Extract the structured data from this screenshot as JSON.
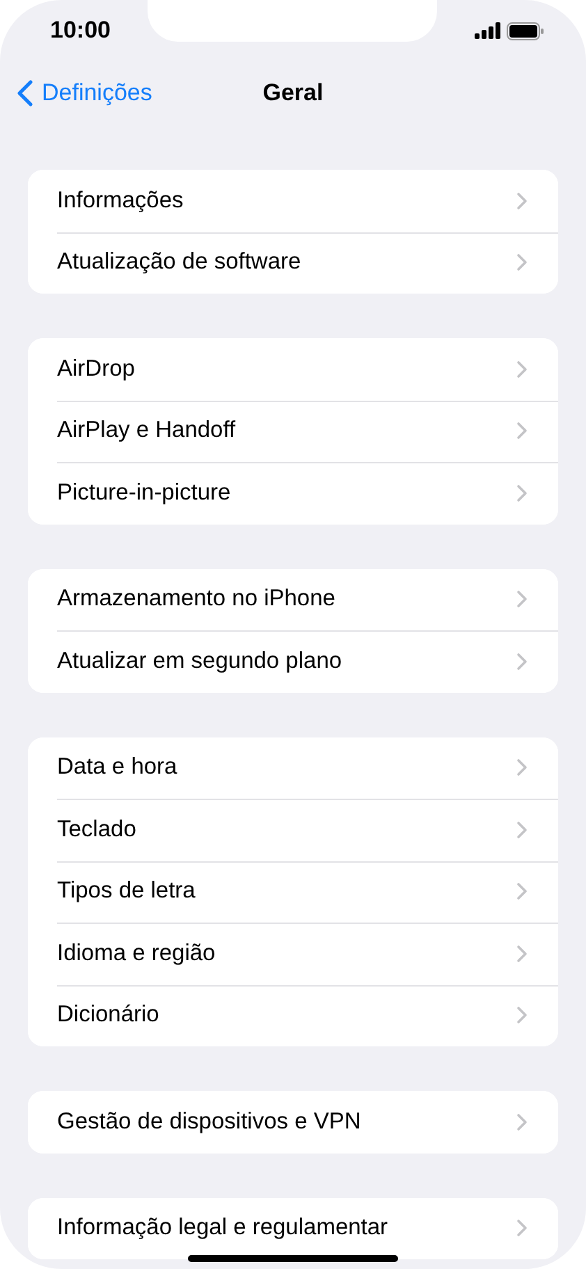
{
  "status_bar": {
    "time": "10:00"
  },
  "nav": {
    "back_label": "Definições",
    "title": "Geral"
  },
  "groups": [
    {
      "items": [
        {
          "label": "Informações"
        },
        {
          "label": "Atualização de software"
        }
      ]
    },
    {
      "items": [
        {
          "label": "AirDrop"
        },
        {
          "label": "AirPlay e Handoff"
        },
        {
          "label": "Picture-in-picture"
        }
      ]
    },
    {
      "items": [
        {
          "label": "Armazenamento no iPhone"
        },
        {
          "label": "Atualizar em segundo plano"
        }
      ]
    },
    {
      "items": [
        {
          "label": "Data e hora"
        },
        {
          "label": "Teclado"
        },
        {
          "label": "Tipos de letra"
        },
        {
          "label": "Idioma e região"
        },
        {
          "label": "Dicionário"
        }
      ]
    },
    {
      "items": [
        {
          "label": "Gestão de dispositivos e VPN"
        }
      ]
    },
    {
      "items": [
        {
          "label": "Informação legal e regulamentar"
        }
      ]
    }
  ]
}
